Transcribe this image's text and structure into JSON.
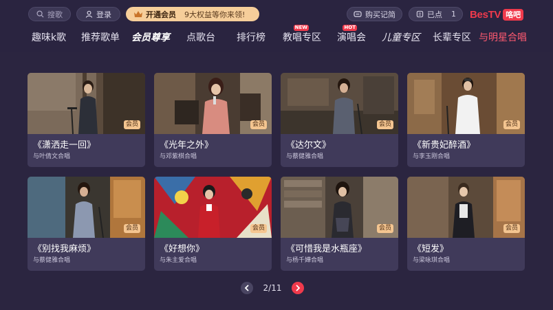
{
  "header": {
    "search_label": "搜歌",
    "login_label": "登录",
    "vip_label": "开通会员",
    "vip_desc": "9大权益等你来领!",
    "bought_label": "购买记简",
    "ordered_label": "已点",
    "ordered_count": "1",
    "brand_text": "BesTV",
    "brand_tag": "咯吧"
  },
  "nav": [
    {
      "label": "趣味k歌"
    },
    {
      "label": "推荐歌单"
    },
    {
      "label": "会员尊享"
    },
    {
      "label": "点歌台"
    },
    {
      "label": "排行榜"
    },
    {
      "label": "教唱专区",
      "badge": "NEW"
    },
    {
      "label": "演唱会",
      "badge": "HOT"
    },
    {
      "label": "儿童专区"
    },
    {
      "label": "长辈专区"
    },
    {
      "label": "与明星合唱"
    }
  ],
  "cards": [
    {
      "title": "《潇洒走一回》",
      "subtitle": "与叶倩文合唱",
      "tag": "会员"
    },
    {
      "title": "《光年之外》",
      "subtitle": "与邓紫棋合唱",
      "tag": "会员"
    },
    {
      "title": "《达尔文》",
      "subtitle": "与蔡健雅合唱",
      "tag": "会员"
    },
    {
      "title": "《新贵妃醉酒》",
      "subtitle": "与李玉刚合唱",
      "tag": "会员"
    },
    {
      "title": "《别找我麻烦》",
      "subtitle": "与蔡健雅合唱",
      "tag": "会员"
    },
    {
      "title": "《好想你》",
      "subtitle": "与朱主爱合唱",
      "tag": "会员"
    },
    {
      "title": "《可惜我是水瓶座》",
      "subtitle": "与杨千嬅合唱",
      "tag": "会员"
    },
    {
      "title": "《短发》",
      "subtitle": "与梁咏琪合唱",
      "tag": "会员"
    }
  ],
  "pager": {
    "text": "2/11"
  },
  "colors": {
    "accent": "#f03a4c",
    "vip": "#f6ce9a",
    "background": "#2b2540",
    "card": "#403a5a"
  }
}
